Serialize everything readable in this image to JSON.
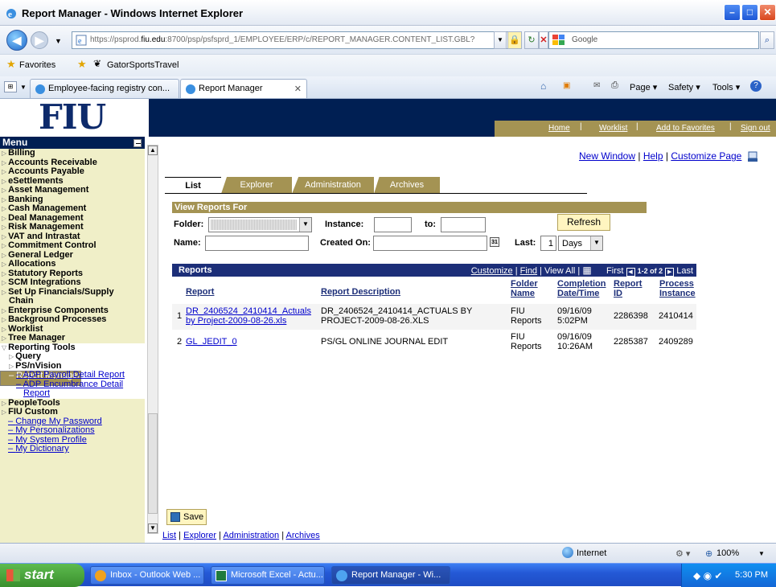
{
  "browser": {
    "title": "Report Manager - Windows Internet Explorer",
    "url_prefix": "https://psprod.",
    "url_domain": "fiu.edu",
    "url_rest": ":8700/psp/psfsprd_1/EMPLOYEE/ERP/c/REPORT_MANAGER.CONTENT_LIST.GBL?",
    "search_engine": "Google",
    "favorites_label": "Favorites",
    "fav_link": "GatorSportsTravel",
    "tabs": [
      "Employee-facing registry con...",
      "Report Manager"
    ],
    "commands": [
      "Page ▾",
      "Safety ▾",
      "Tools ▾"
    ],
    "status_zone": "Internet",
    "zoom": "100%"
  },
  "app": {
    "logo": "FIU",
    "topnav": [
      "Home",
      "Worklist",
      "Add to Favorites",
      "Sign out"
    ],
    "page_links": [
      "New Window",
      "Help",
      "Customize Page"
    ]
  },
  "menu": {
    "title": "Menu",
    "items": [
      {
        "label": "Billing",
        "kind": "folder"
      },
      {
        "label": "Accounts Receivable",
        "kind": "folder"
      },
      {
        "label": "Accounts Payable",
        "kind": "folder"
      },
      {
        "label": "eSettlements",
        "kind": "folder"
      },
      {
        "label": "Asset Management",
        "kind": "folder"
      },
      {
        "label": "Banking",
        "kind": "folder"
      },
      {
        "label": "Cash Management",
        "kind": "folder"
      },
      {
        "label": "Deal Management",
        "kind": "folder"
      },
      {
        "label": "Risk Management",
        "kind": "folder"
      },
      {
        "label": "VAT and Intrastat",
        "kind": "folder"
      },
      {
        "label": "Commitment Control",
        "kind": "folder"
      },
      {
        "label": "General Ledger",
        "kind": "folder"
      },
      {
        "label": "Allocations",
        "kind": "folder"
      },
      {
        "label": "Statutory Reports",
        "kind": "folder"
      },
      {
        "label": "SCM Integrations",
        "kind": "folder"
      },
      {
        "label": "Set Up Financials/Supply",
        "kind": "folder"
      },
      {
        "label": "Chain",
        "kind": "cont"
      },
      {
        "label": "Enterprise Components",
        "kind": "folder"
      },
      {
        "label": "Background Processes",
        "kind": "folder"
      },
      {
        "label": "Worklist",
        "kind": "folder"
      },
      {
        "label": "Tree Manager",
        "kind": "folder"
      },
      {
        "label": "Reporting Tools",
        "kind": "open"
      },
      {
        "label": "Query",
        "kind": "subfolder"
      },
      {
        "label": "PS/nVision",
        "kind": "subfolder"
      },
      {
        "label": "Report Manager",
        "kind": "selected"
      },
      {
        "label": "ADP Payroll Detail Report",
        "kind": "sublink"
      },
      {
        "label": "ADP Encumbrance Detail",
        "kind": "sublink"
      },
      {
        "label": "Report",
        "kind": "sublinkcont"
      },
      {
        "label": "PeopleTools",
        "kind": "folder"
      },
      {
        "label": "FIU Custom",
        "kind": "folder"
      },
      {
        "label": "Change My Password",
        "kind": "link"
      },
      {
        "label": "My Personalizations",
        "kind": "link"
      },
      {
        "label": "My System Profile",
        "kind": "link"
      },
      {
        "label": "My Dictionary",
        "kind": "link"
      }
    ]
  },
  "tabs": [
    "List",
    "Explorer",
    "Administration",
    "Archives"
  ],
  "filters": {
    "section": "View Reports For",
    "folder_label": "Folder:",
    "instance_label": "Instance:",
    "to_label": "to:",
    "refresh": "Refresh",
    "name_label": "Name:",
    "created_label": "Created On:",
    "last_label": "Last:",
    "last_value": "1",
    "last_unit": "Days"
  },
  "reports": {
    "title": "Reports",
    "nav": [
      "Customize",
      "Find",
      "View All"
    ],
    "first": "First",
    "range": "1-2 of 2",
    "last": "Last",
    "columns": [
      "Report",
      "Report Description",
      "Folder Name",
      "Completion Date/Time",
      "Report ID",
      "Process Instance"
    ],
    "rows": [
      {
        "num": "1",
        "report": "DR_2406524_2410414_Actuals by Project-2009-08-26.xls",
        "desc": "DR_2406524_2410414_ACTUALS BY PROJECT-2009-08-26.XLS",
        "folder": "FIU Reports",
        "date": "09/16/09 5:02PM",
        "id": "2286398",
        "instance": "2410414"
      },
      {
        "num": "2",
        "report": "GL_JEDIT_0",
        "desc": "PS/GL ONLINE JOURNAL EDIT",
        "folder": "FIU Reports",
        "date": "09/16/09 10:26AM",
        "id": "2285387",
        "instance": "2409289"
      }
    ]
  },
  "save_label": "Save",
  "bottom_links": [
    "List",
    "Explorer",
    "Administration",
    "Archives"
  ],
  "taskbar": {
    "start": "start",
    "tasks": [
      "Inbox - Outlook Web ...",
      "Microsoft Excel - Actu...",
      "Report Manager - Wi..."
    ],
    "clock": "5:30 PM"
  }
}
